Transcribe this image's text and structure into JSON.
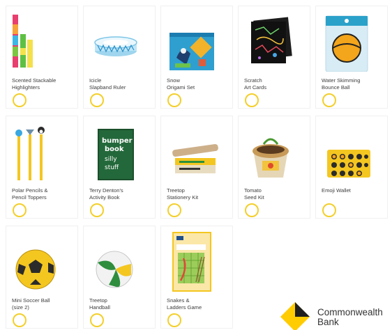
{
  "products": [
    {
      "name": "Scented Stackable\nHighlighters",
      "icon": "highlighters-icon"
    },
    {
      "name": "Icicle\nSlapband Ruler",
      "icon": "ruler-icon"
    },
    {
      "name": "Snow\nOrigami Set",
      "icon": "origami-icon"
    },
    {
      "name": "Scratch\nArt Cards",
      "icon": "scratch-cards-icon"
    },
    {
      "name": "Water Skimming\nBounce Ball",
      "icon": "bounce-ball-icon"
    },
    {
      "name": "Polar Pencils &\nPencil Toppers",
      "icon": "pencils-icon"
    },
    {
      "name": "Terry Denton's\nActivity Book",
      "icon": "book-icon"
    },
    {
      "name": "Treetop\nStationery Kit",
      "icon": "stationery-kit-icon"
    },
    {
      "name": "Tomato\nSeed Kit",
      "icon": "seed-kit-icon"
    },
    {
      "name": "Emoji Wallet",
      "icon": "wallet-icon"
    },
    {
      "name": "Mini Soccer Ball\n(size 2)",
      "icon": "soccer-ball-icon"
    },
    {
      "name": "Treetop\nHandball",
      "icon": "handball-icon"
    },
    {
      "name": "Snakes &\nLadders Game",
      "icon": "board-game-icon"
    }
  ],
  "book_cover": {
    "line1": "bumper",
    "line2": "book",
    "line3": "silly",
    "line4": "stuff"
  },
  "brand": {
    "name": "Commonwealth\nBank",
    "color": "#FFCC00"
  },
  "colors": {
    "select_ring": "#F3CF2A"
  }
}
